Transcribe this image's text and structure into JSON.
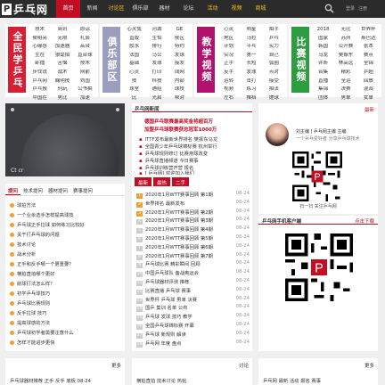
{
  "nav": {
    "logo_mark": "P",
    "logo_text": "乒乓网",
    "items": [
      "首页",
      "新闻",
      "讨论区",
      "俱乐部",
      "器材",
      "论坛",
      "活动",
      "视频",
      "商城"
    ],
    "right": [
      "登录",
      "注册"
    ]
  },
  "categories": [
    {
      "title": "全民学乒乓",
      "color": "#d81e32",
      "links": [
        "技术",
        "简讯",
        "原谅",
        "侯明亮",
        "无限",
        "礼辰",
        "心缘感",
        "加速器",
        "高台",
        "生在",
        "狼毫拍",
        "直台球",
        "卧擂",
        "苦恼",
        "技术",
        "步伐说",
        "战术",
        "网前",
        "乒乓网",
        "鞠明技",
        "刘国",
        "乒乓报",
        "刑玩",
        "公书拍",
        "中国在",
        "男比",
        "加速"
      ]
    },
    {
      "title": "俱乐部区",
      "color": "#9c9ec0",
      "links": [
        "心灵兔",
        "河湖",
        "GE",
        "直版",
        "生怕",
        "侯区",
        "胶水",
        "排行",
        "特约",
        "法国",
        "马公",
        "发球",
        "基础",
        "发球",
        "接发",
        "心灵",
        "打印",
        "阔网",
        "技",
        "科技",
        "内部",
        "球室",
        "通经",
        "球技",
        "比",
        "光启",
        "帮对"
      ]
    },
    {
      "title": "教学视频",
      "color": "#b2116d",
      "links": [
        "心灵",
        "明星",
        "拍手",
        "地区",
        "马拉",
        "乒乓",
        "计划",
        "平乓",
        "实力",
        "实况",
        "第一",
        "自己",
        "正手",
        "长短",
        "弧圈",
        "反手",
        "发球",
        "点对",
        "运转",
        "击打",
        "接受",
        "视频",
        "练习",
        "拍法",
        "左右",
        "推挡",
        "搓球"
      ]
    },
    {
      "title": "比赛视频",
      "color": "#2d9d3f",
      "links": [
        "2018",
        "无比",
        "世界杯",
        "国家",
        "苏州",
        "斯巴达",
        "韩国",
        "公开赛",
        "张本",
        "马龙",
        "樊振东",
        "赛点",
        "许昕",
        "林高远",
        "全锦",
        "合集",
        "精彩",
        "乒超",
        "直播",
        "全运",
        "回放",
        "集锦",
        "决赛",
        "混双",
        "团体",
        "男单",
        "女单"
      ]
    }
  ],
  "photo": {
    "caption": "Ct cr"
  },
  "news": {
    "header": "乒乓网新闻",
    "headlines": [
      "德国乒乓联赛最高奖金将超百万",
      "加盟乒乓球联赛获总冠军1000万"
    ],
    "items": [
      "ITTF发布最新世界排名 樊振东马龙",
      "全国青少年乒乓球锦标赛 杭州举行",
      "乒乓球规则修订 比赛用球改变",
      "乒乓球直播频道 今日赛事",
      "乒乓球训练营开营 报名",
      "[ 乒乓网] 欢迎加入我们"
    ]
  },
  "profile": {
    "more": "最新",
    "name": "刘主编 | 乒乓网主编 主编",
    "sub": "一个乒乓爱好者 分享乒乓球技术",
    "qr_caption": "扫一扫 关注乒乓网"
  },
  "talk": {
    "tabs": [
      "提问",
      "技术提问",
      "器材提问",
      "赛事提问"
    ],
    "items": [
      "球拍方法",
      "一个业余选手怎样提高球技",
      "乒乓球正手拉球 如何练习比较好",
      "关于打乒乓球的问题",
      "技术讨论",
      "战术分析",
      "正手和反手哪一个更重要？",
      "横拍直拍哪个更好",
      "削球打法怎么样？",
      "初学乒乓球技巧",
      "乒乓球比赛规则",
      "反手拉球 技巧",
      "提高球感的方法",
      "乒乓球初学者需要注意什么",
      "怎样才能进步更快"
    ]
  },
  "list": {
    "tabs": [
      "最新",
      "最热",
      "二手"
    ],
    "rows": [
      {
        "n": "1",
        "t": "2020年1月WTT赛事回顾 第1期",
        "d": "08-24"
      },
      {
        "n": "2",
        "t": "世界排名 最新发布",
        "d": "08-24"
      },
      {
        "n": "3",
        "t": "2020年1月WTT赛事回顾 第2期",
        "d": "08-24"
      },
      {
        "n": "4",
        "t": "2020年1月WTT赛事回顾 第3期",
        "d": "08-24"
      },
      {
        "n": "5",
        "t": "2020年1月WTT赛事回顾 第4期",
        "d": "08-24"
      },
      {
        "n": "6",
        "t": "2020年1月WTT赛事回顾 第5期",
        "d": "08-24"
      },
      {
        "n": "7",
        "t": "2020年1月WTT赛事回顾 第6期",
        "d": "08-24"
      },
      {
        "n": "8",
        "t": "2020年1月WTT赛事回顾 第7期",
        "d": "08-24"
      },
      {
        "n": "9",
        "t": "乒乓球比赛 精彩瞬间 回顾",
        "d": "08-24"
      },
      {
        "n": "10",
        "t": "中国乒乓球队 备战奥运会",
        "d": "08-24"
      },
      {
        "n": "11",
        "t": "乒乓球器材评测 推荐",
        "d": "08-24"
      },
      {
        "n": "12",
        "t": "比赛直播 乒乓球 赛事",
        "d": "08-24"
      },
      {
        "n": "13",
        "t": "世界杯 乒乓球 男单 决赛",
        "d": "08-24"
      },
      {
        "n": "14",
        "t": "国乒 集训 名单 公布",
        "d": "08-24"
      },
      {
        "n": "15",
        "t": "乒乓球 发球 技巧 教学",
        "d": "08-24"
      },
      {
        "n": "16",
        "t": "全国乒乓球锦标赛 开幕",
        "d": "08-24"
      },
      {
        "n": "17",
        "t": "乒乓球 新规则 解读",
        "d": "08-24"
      },
      {
        "n": "18",
        "t": "乒乓网 年度 盘点",
        "d": "08-24"
      }
    ]
  },
  "app": {
    "title": "乒乓网手机客户端",
    "link": "点击下载"
  },
  "bottom": [
    {
      "more": "更多",
      "text": "乒乓球器材推荐 正手 反手 底板 08-24"
    },
    {
      "more": "讨论",
      "text": "横拍直拍 技术讨论 热帖"
    },
    {
      "more": "更多",
      "text": "乒乓网 最新 活动 报名 赛事"
    }
  ],
  "colors": {
    "nav": "#2b2b2b",
    "accent": "#c30d23"
  }
}
